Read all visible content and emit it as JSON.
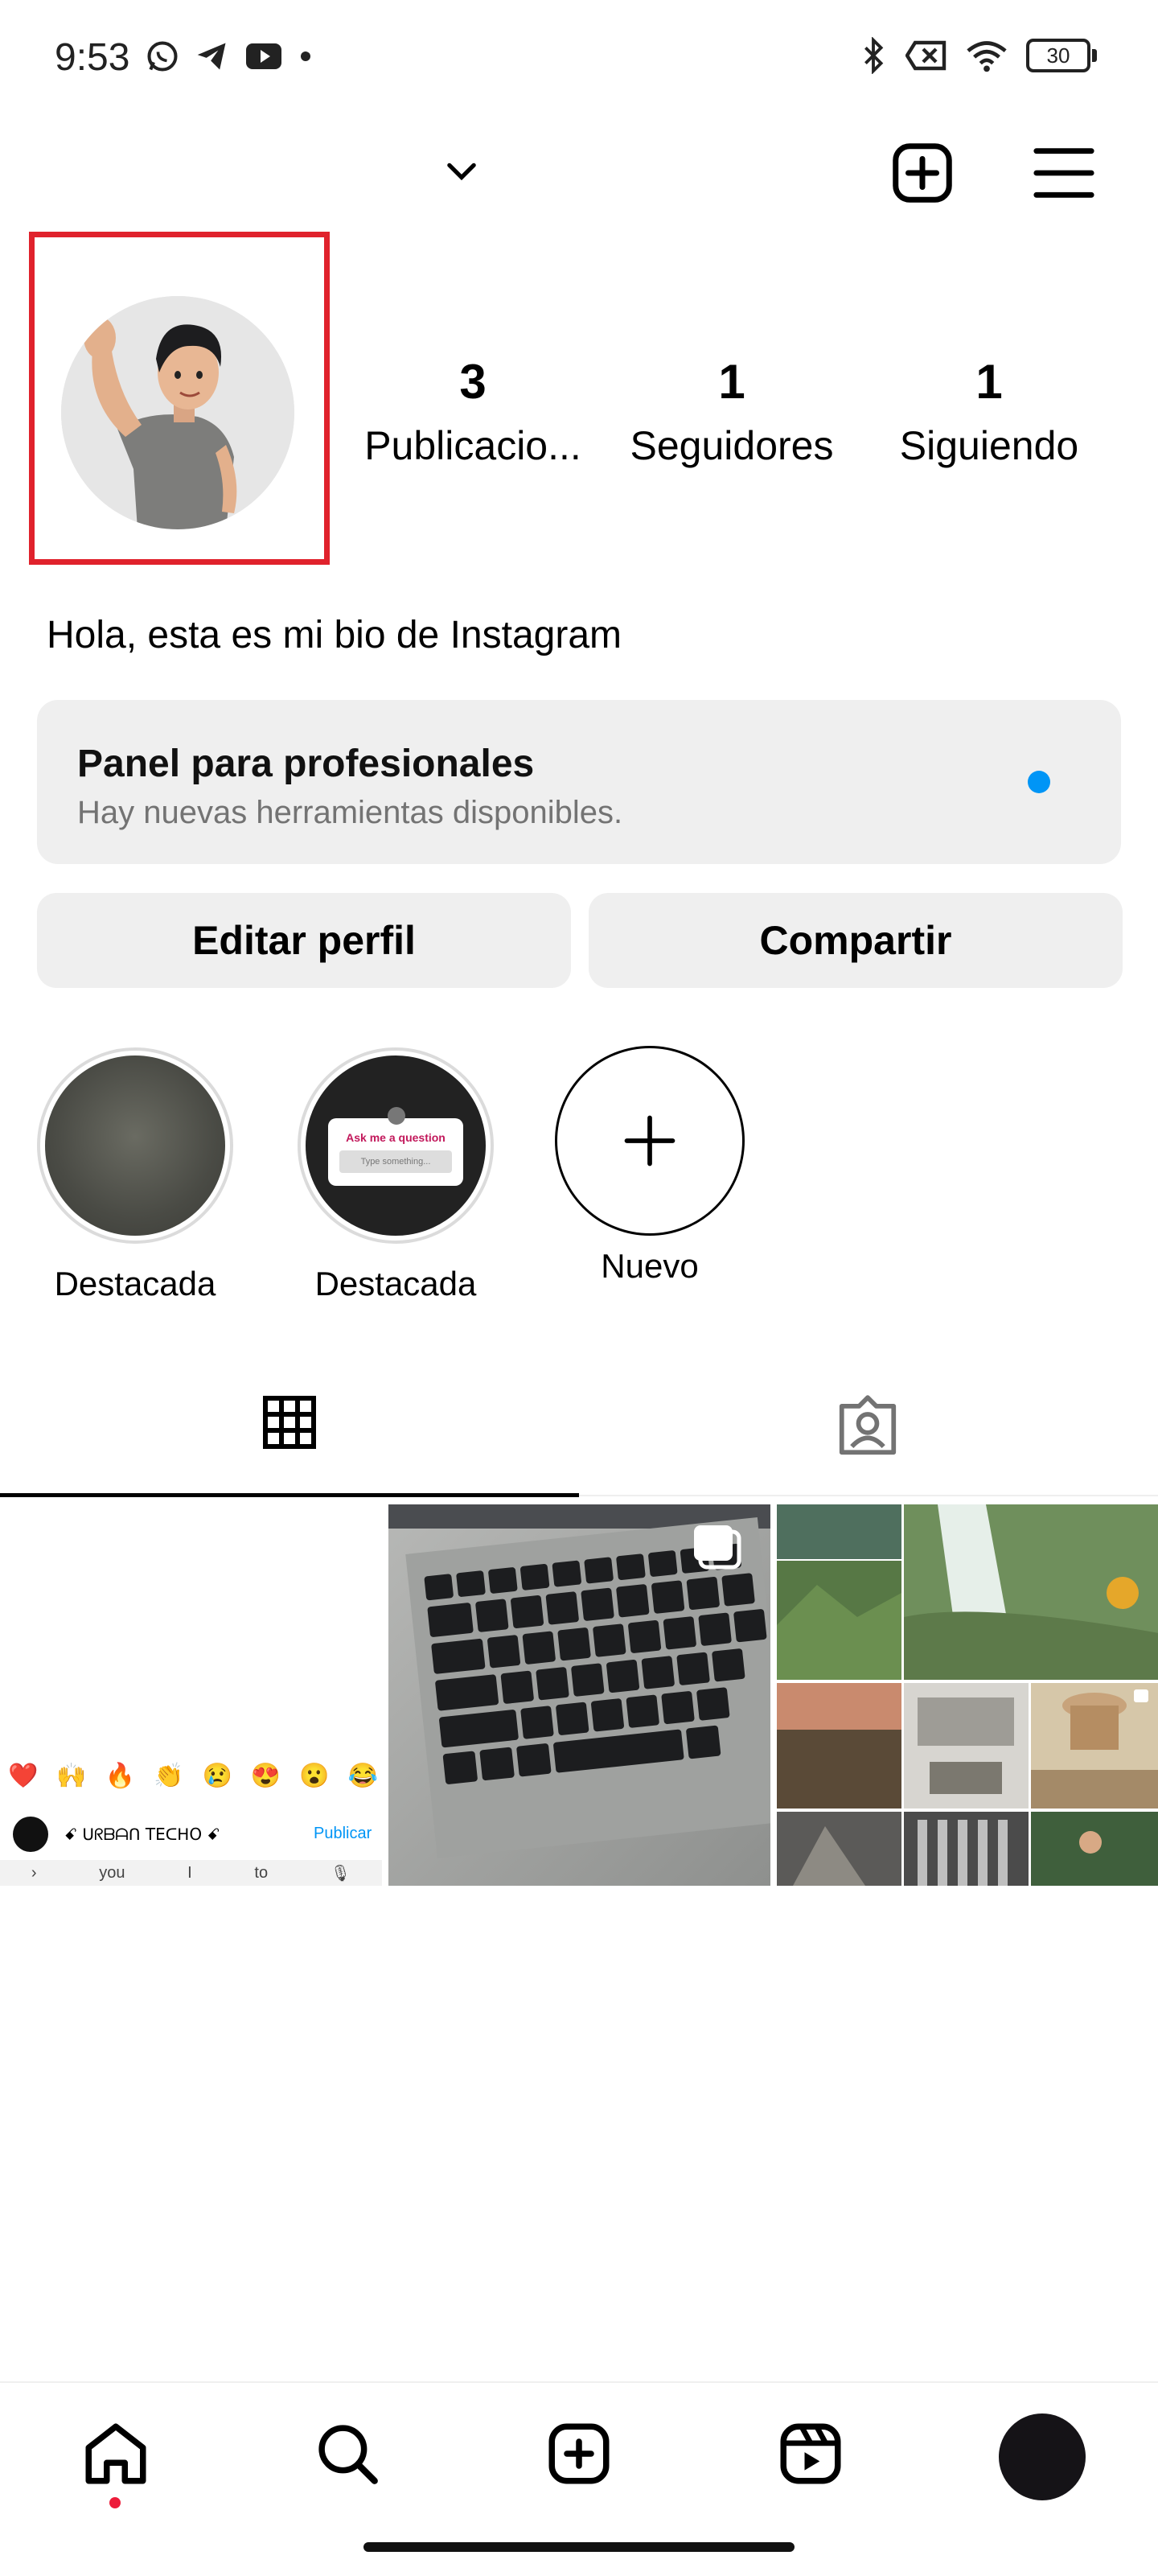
{
  "status_bar": {
    "time": "9:53",
    "battery": "30",
    "left_icons": [
      "whatsapp-icon",
      "telegram-icon",
      "youtube-icon",
      "dot-icon"
    ],
    "right_icons": [
      "bluetooth-icon",
      "no-sim-icon",
      "wifi-icon",
      "battery-icon"
    ]
  },
  "header": {
    "account_switcher_icon": "chevron-down-icon",
    "create_icon": "plus-square-icon",
    "menu_icon": "hamburger-icon"
  },
  "profile": {
    "stats": [
      {
        "value": "3",
        "label": "Publicacio..."
      },
      {
        "value": "1",
        "label": "Seguidores"
      },
      {
        "value": "1",
        "label": "Siguiendo"
      }
    ],
    "bio": "Hola, esta es mi bio de Instagram"
  },
  "pro_panel": {
    "title": "Panel para profesionales",
    "subtitle": "Hay nuevas herramientas disponibles.",
    "dot_color": "#0095f6"
  },
  "actions": {
    "edit_label": "Editar perfil",
    "share_label": "Compartir"
  },
  "highlights": [
    {
      "label": "Destacada"
    },
    {
      "label": "Destacada",
      "card_title": "Ask me a question",
      "card_input": "Type something..."
    },
    {
      "label": "Nuevo"
    }
  ],
  "tabs": [
    {
      "icon": "grid-icon",
      "selected": true
    },
    {
      "icon": "tagged-person-icon",
      "selected": false
    }
  ],
  "posts": [
    {
      "emojis": [
        "❤️",
        "🙌",
        "🔥",
        "👏",
        "😢",
        "😍",
        "😮",
        "😂"
      ],
      "username": "ꗃ ᑌᖇᗷᗩᑎ TEᑕᕼO ꗃ",
      "publish_label": "Publicar",
      "suggestions": [
        "you",
        "I",
        "to"
      ]
    },
    {
      "type": "photo",
      "multi": true
    },
    {
      "type": "collage",
      "multi": true
    }
  ],
  "bottom_nav": [
    "home-icon",
    "search-icon",
    "create-icon",
    "reels-icon",
    "profile-avatar"
  ],
  "colors": {
    "highlight_frame": "#e0222c",
    "accent_blue": "#0095f6",
    "surface_gray": "#efefef",
    "notification_dot": "#ed1c3a"
  }
}
